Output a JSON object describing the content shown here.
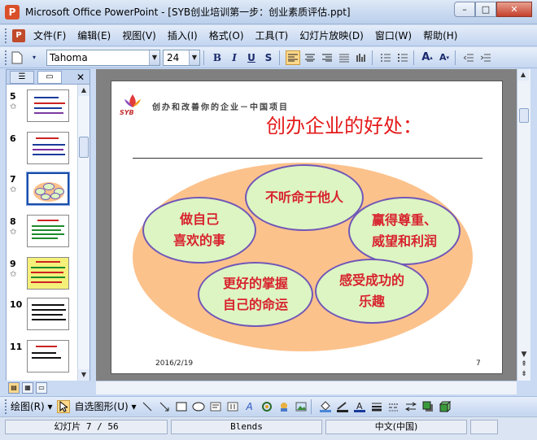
{
  "window": {
    "title": "Microsoft Office PowerPoint - [SYB创业培训第一步：创业素质评估.ppt]",
    "app_icon_letter": "P",
    "min_label": "–",
    "restore_label": "□",
    "close_label": "✕"
  },
  "menu": {
    "items": [
      "文件(F)",
      "编辑(E)",
      "视图(V)",
      "插入(I)",
      "格式(O)",
      "工具(T)",
      "幻灯片放映(D)",
      "窗口(W)",
      "帮助(H)"
    ]
  },
  "toolbar": {
    "font_name": "Tahoma",
    "font_size": "24",
    "bold": "B",
    "italic": "I",
    "underline": "U",
    "shadow": "S"
  },
  "slides_pane": {
    "close_label": "✕",
    "thumbnails": [
      {
        "number": "5",
        "has_animation": true
      },
      {
        "number": "6",
        "has_animation": false
      },
      {
        "number": "7",
        "has_animation": true,
        "selected": true
      },
      {
        "number": "8",
        "has_animation": true
      },
      {
        "number": "9",
        "has_animation": true
      },
      {
        "number": "10",
        "has_animation": false
      },
      {
        "number": "11",
        "has_animation": false
      }
    ]
  },
  "slide": {
    "logo_text": "SYB",
    "header": "创办和改善你的企业－中国项目",
    "title": "创办企业的好处：",
    "bubbles": [
      "做自己\n喜欢的事",
      "不听命于他人",
      "赢得尊重、\n威望和利润",
      "更好的掌握\n自己的命运",
      "感受成功的\n乐趣"
    ],
    "date": "2016/2/19",
    "page_number": "7"
  },
  "drawing_toolbar": {
    "draw_label": "绘图(R) ▾",
    "autoshapes_label": "自选图形(U) ▾"
  },
  "status": {
    "slide_info": "幻灯片 7 / 56",
    "design": "Blends",
    "language": "中文(中国)"
  },
  "colors": {
    "title_red": "#e41b1b",
    "ellipse_orange": "#fcc28c",
    "bubble_green": "#ddf5c2",
    "bubble_border": "#6f57b8"
  }
}
